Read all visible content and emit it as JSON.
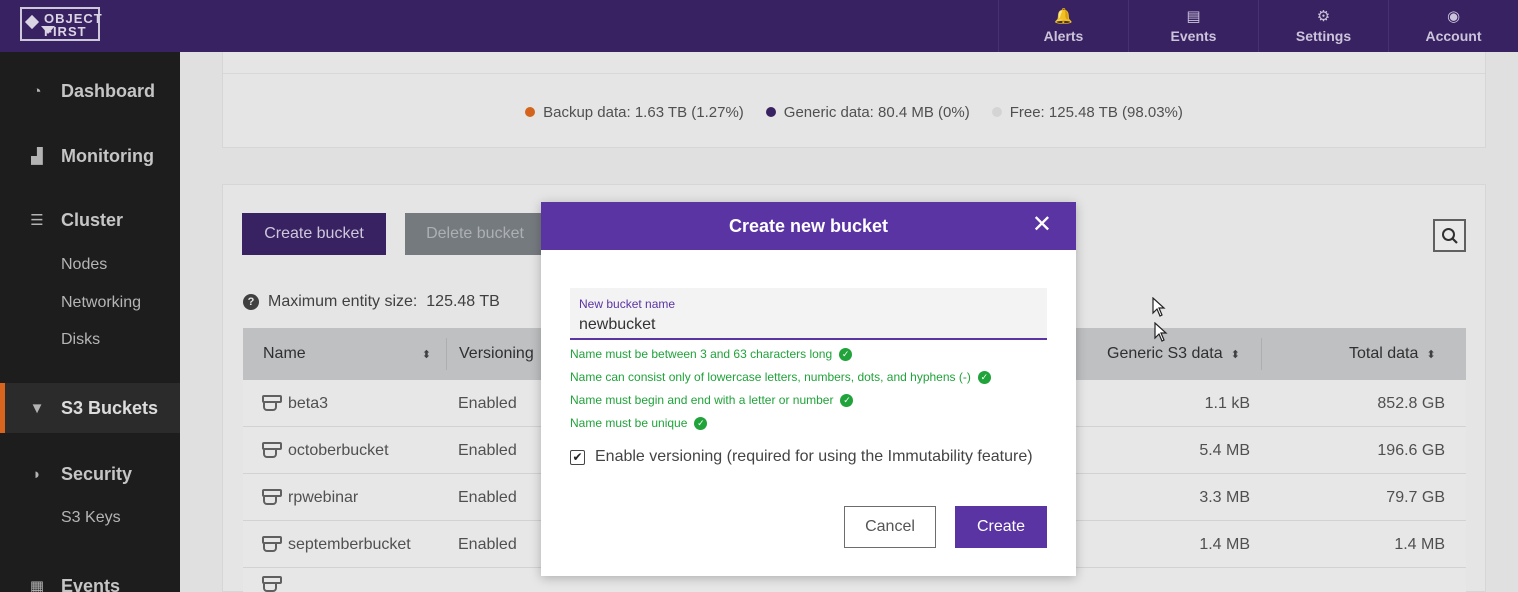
{
  "app": {
    "logo_text": "OBJECT\nFIRST"
  },
  "topnav": [
    {
      "label": "Alerts",
      "icon": "bell-icon",
      "glyph": "🔔"
    },
    {
      "label": "Events",
      "icon": "list-icon",
      "glyph": "▤"
    },
    {
      "label": "Settings",
      "icon": "gear-icon",
      "glyph": "⚙"
    },
    {
      "label": "Account",
      "icon": "user-icon",
      "glyph": "◉"
    }
  ],
  "sidebar": {
    "items": [
      {
        "label": "Dashboard",
        "glyph": "◔"
      },
      {
        "label": "Monitoring",
        "glyph": "▟"
      },
      {
        "label": "Cluster",
        "glyph": "☰"
      },
      {
        "label": "S3 Buckets",
        "glyph": "▼"
      },
      {
        "label": "Security",
        "glyph": "◗"
      },
      {
        "label": "Events",
        "glyph": "▦"
      }
    ],
    "cluster_sub": [
      "Nodes",
      "Networking",
      "Disks"
    ],
    "security_sub": [
      "S3 Keys"
    ]
  },
  "usage_legend": [
    {
      "label": "Backup data: 1.63 TB (1.27%)",
      "color": "#e06a1f"
    },
    {
      "label": "Generic data: 80.4 MB (0%)",
      "color": "#3d2468"
    },
    {
      "label": "Free: 125.48 TB (98.03%)",
      "color": "#e0e0e0"
    }
  ],
  "toolbar": {
    "create_label": "Create bucket",
    "delete_label": "Delete bucket"
  },
  "max_entity": {
    "label": "Maximum entity size:",
    "value": "125.48 TB"
  },
  "table": {
    "headers": {
      "name": "Name",
      "versioning": "Versioning",
      "generic": "Generic S3 data",
      "total": "Total data"
    },
    "rows": [
      {
        "name": "beta3",
        "versioning": "Enabled",
        "generic": "1.1 kB",
        "total": "852.8 GB"
      },
      {
        "name": "octoberbucket",
        "versioning": "Enabled",
        "generic": "5.4 MB",
        "total": "196.6 GB"
      },
      {
        "name": "rpwebinar",
        "versioning": "Enabled",
        "generic": "3.3 MB",
        "total": "79.7 GB"
      },
      {
        "name": "septemberbucket",
        "versioning": "Enabled",
        "generic": "1.4 MB",
        "total": "1.4 MB"
      }
    ]
  },
  "modal": {
    "title": "Create new bucket",
    "field_label": "New bucket name",
    "field_value": "newbucket",
    "rules": [
      "Name must be between 3 and 63 characters long",
      "Name can consist only of lowercase letters, numbers, dots, and hyphens (-)",
      "Name must begin and end with a letter or number",
      "Name must be unique"
    ],
    "versioning_label": "Enable versioning (required for using the Immutability feature)",
    "versioning_checked": true,
    "cancel_label": "Cancel",
    "create_label": "Create"
  }
}
